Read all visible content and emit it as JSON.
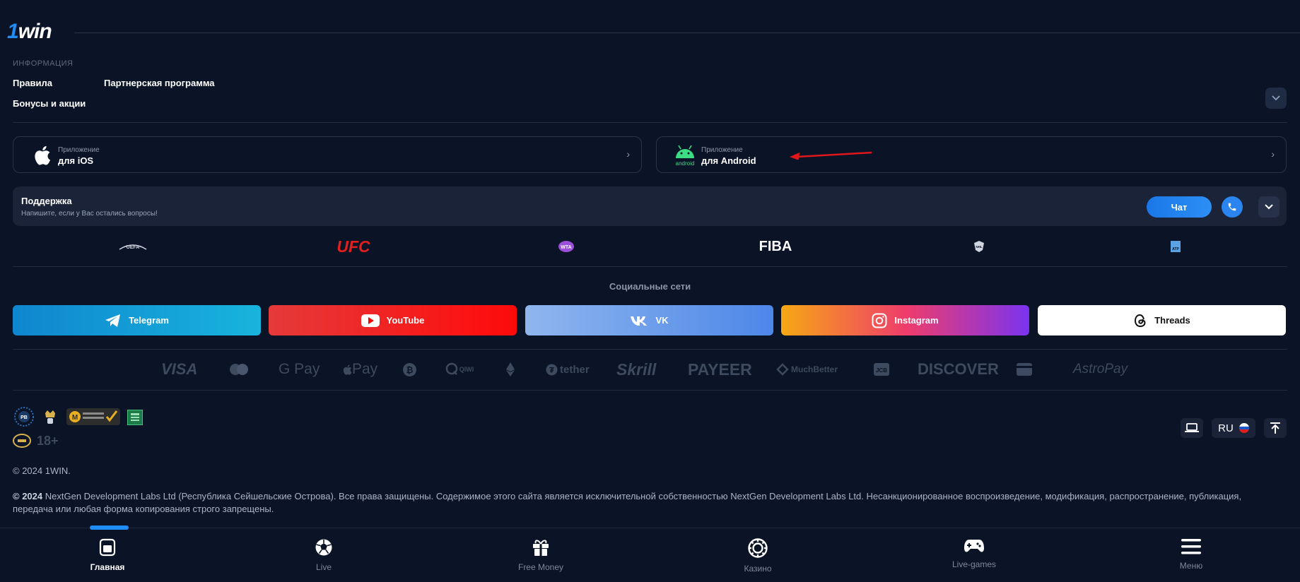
{
  "header": {
    "logo": "1win"
  },
  "info": {
    "title": "ИНФОРМАЦИЯ",
    "links": [
      "Правила",
      "Партнерская программа",
      "Бонусы и акции"
    ]
  },
  "apps": {
    "ios": {
      "small": "Приложение",
      "big": "для iOS",
      "icon": "apple-icon"
    },
    "android": {
      "small": "Приложение",
      "big": "для Android",
      "icon": "android-icon",
      "icon_text": "android"
    }
  },
  "support": {
    "title": "Поддержка",
    "subtitle": "Напишите, если у Вас остались вопросы!",
    "chat_label": "Чат"
  },
  "partners": [
    "UEFA",
    "UFC",
    "WTA",
    "FIBA",
    "NHL",
    "ATP"
  ],
  "social": {
    "title": "Социальные сети",
    "items": [
      {
        "label": "Telegram",
        "icon": "telegram-icon"
      },
      {
        "label": "YouTube",
        "icon": "youtube-icon"
      },
      {
        "label": "VK",
        "icon": "vk-icon"
      },
      {
        "label": "Instagram",
        "icon": "instagram-icon"
      },
      {
        "label": "Threads",
        "icon": "threads-icon"
      }
    ]
  },
  "payments": [
    "VISA",
    "Mastercard",
    "G Pay",
    "Pay",
    "Bitcoin",
    "QIWI",
    "Ethereum",
    "tether",
    "Skrill",
    "PAYEER",
    "MuchBetter",
    "JCB",
    "DISCOVER",
    "Card",
    "AstroPay"
  ],
  "badges": {
    "age": "18+"
  },
  "tools": {
    "language": "RU"
  },
  "copyright": {
    "line1": "© 2024 1WIN.",
    "line2_bold": "© 2024",
    "line2": "NextGen Development Labs Ltd (Республика Сейшельские Острова). Все права защищены. Содержимое этого сайта является исключительной собственностью NextGen Development Labs Ltd. Несанкционированное воспроизведение, модификация, распространение, публикация, передача или любая форма копирования строго запрещены."
  },
  "bottom_nav": {
    "active": "Главная",
    "items": [
      {
        "label": "Главная",
        "icon": "home-icon"
      },
      {
        "label": "Live",
        "icon": "soccer-ball-icon"
      },
      {
        "label": "Free Money",
        "icon": "gift-icon"
      },
      {
        "label": "Казино",
        "icon": "casino-chip-icon"
      },
      {
        "label": "Live-games",
        "icon": "gamepad-icon"
      },
      {
        "label": "Меню",
        "icon": "menu-icon"
      }
    ]
  },
  "colors": {
    "background": "#0b1426",
    "accent": "#1f8df5",
    "android_green": "#3ddc84"
  }
}
